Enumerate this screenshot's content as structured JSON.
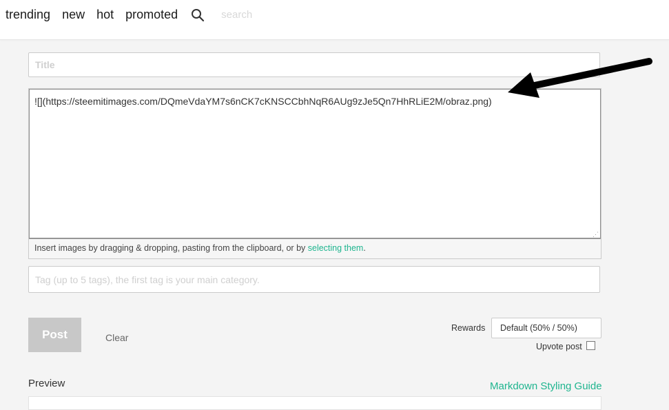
{
  "nav": {
    "items": [
      "trending",
      "new",
      "hot",
      "promoted"
    ],
    "search_placeholder": "search"
  },
  "editor": {
    "title_placeholder": "Title",
    "body_value": "![](https://steemitimages.com/DQmeVdaYM7s6nCK7cKNSCCbhNqR6AUg9zJe5Qn7HhRLiE2M/obraz.png)",
    "help_text": "Insert images by dragging & dropping, pasting from the clipboard, or by ",
    "help_link": "selecting them",
    "help_end": ".",
    "tags_placeholder": "Tag (up to 5 tags), the first tag is your main category."
  },
  "actions": {
    "post_label": "Post",
    "clear_label": "Clear",
    "rewards_label": "Rewards",
    "rewards_value": "Default (50% / 50%)",
    "upvote_label": "Upvote post"
  },
  "preview": {
    "title": "Preview",
    "guide_link": "Markdown Styling Guide"
  },
  "colors": {
    "accent": "#1fb58f",
    "post_button": "#c8c8c8"
  },
  "icons": {
    "search": "search-icon",
    "annotation": "arrow-annotation-icon"
  }
}
